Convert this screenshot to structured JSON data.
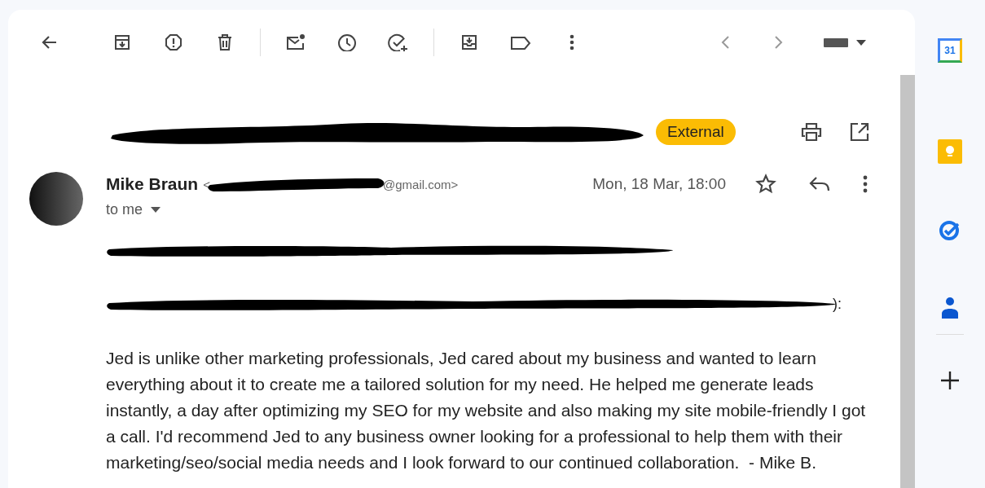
{
  "toolbar": {
    "left": [
      {
        "kind": "back"
      },
      {
        "kind": "archive"
      },
      {
        "kind": "spam"
      },
      {
        "kind": "delete"
      },
      {
        "kind": "sep"
      },
      {
        "kind": "unread"
      },
      {
        "kind": "snooze"
      },
      {
        "kind": "task"
      },
      {
        "kind": "sep"
      },
      {
        "kind": "move"
      },
      {
        "kind": "label"
      },
      {
        "kind": "more"
      }
    ],
    "right": [
      {
        "kind": "prev"
      },
      {
        "kind": "next"
      },
      {
        "kind": "keyboard"
      }
    ]
  },
  "subject": {
    "badge": "External"
  },
  "message": {
    "sender_name": "Mike Braun",
    "email_start": "<",
    "email_end": "@gmail.com>",
    "date": "Mon, 18 Mar, 18:00",
    "recipient": "to me",
    "redacted_lines": [
      {
        "kind": "plain"
      },
      {
        "kind": "with_tail",
        "tail": "):"
      }
    ],
    "paragraph": "Jed is unlike other marketing professionals, Jed cared about my business and wanted to learn everything about it to create me a tailored solution for my need. He helped me generate leads instantly, a day after optimizing my SEO for my website and also making my site mobile-friendly I got a call. I'd recommend Jed to any business owner looking for a professional to help them with their marketing/seo/social media needs and I look forward to our continued collaboration.  - Mike B."
  },
  "side_panel": {
    "calendar_day": "31",
    "apps": [
      {
        "kind": "calendar"
      },
      {
        "kind": "keep"
      },
      {
        "kind": "tasks"
      },
      {
        "kind": "contacts"
      },
      {
        "kind": "sep"
      },
      {
        "kind": "add"
      }
    ]
  }
}
